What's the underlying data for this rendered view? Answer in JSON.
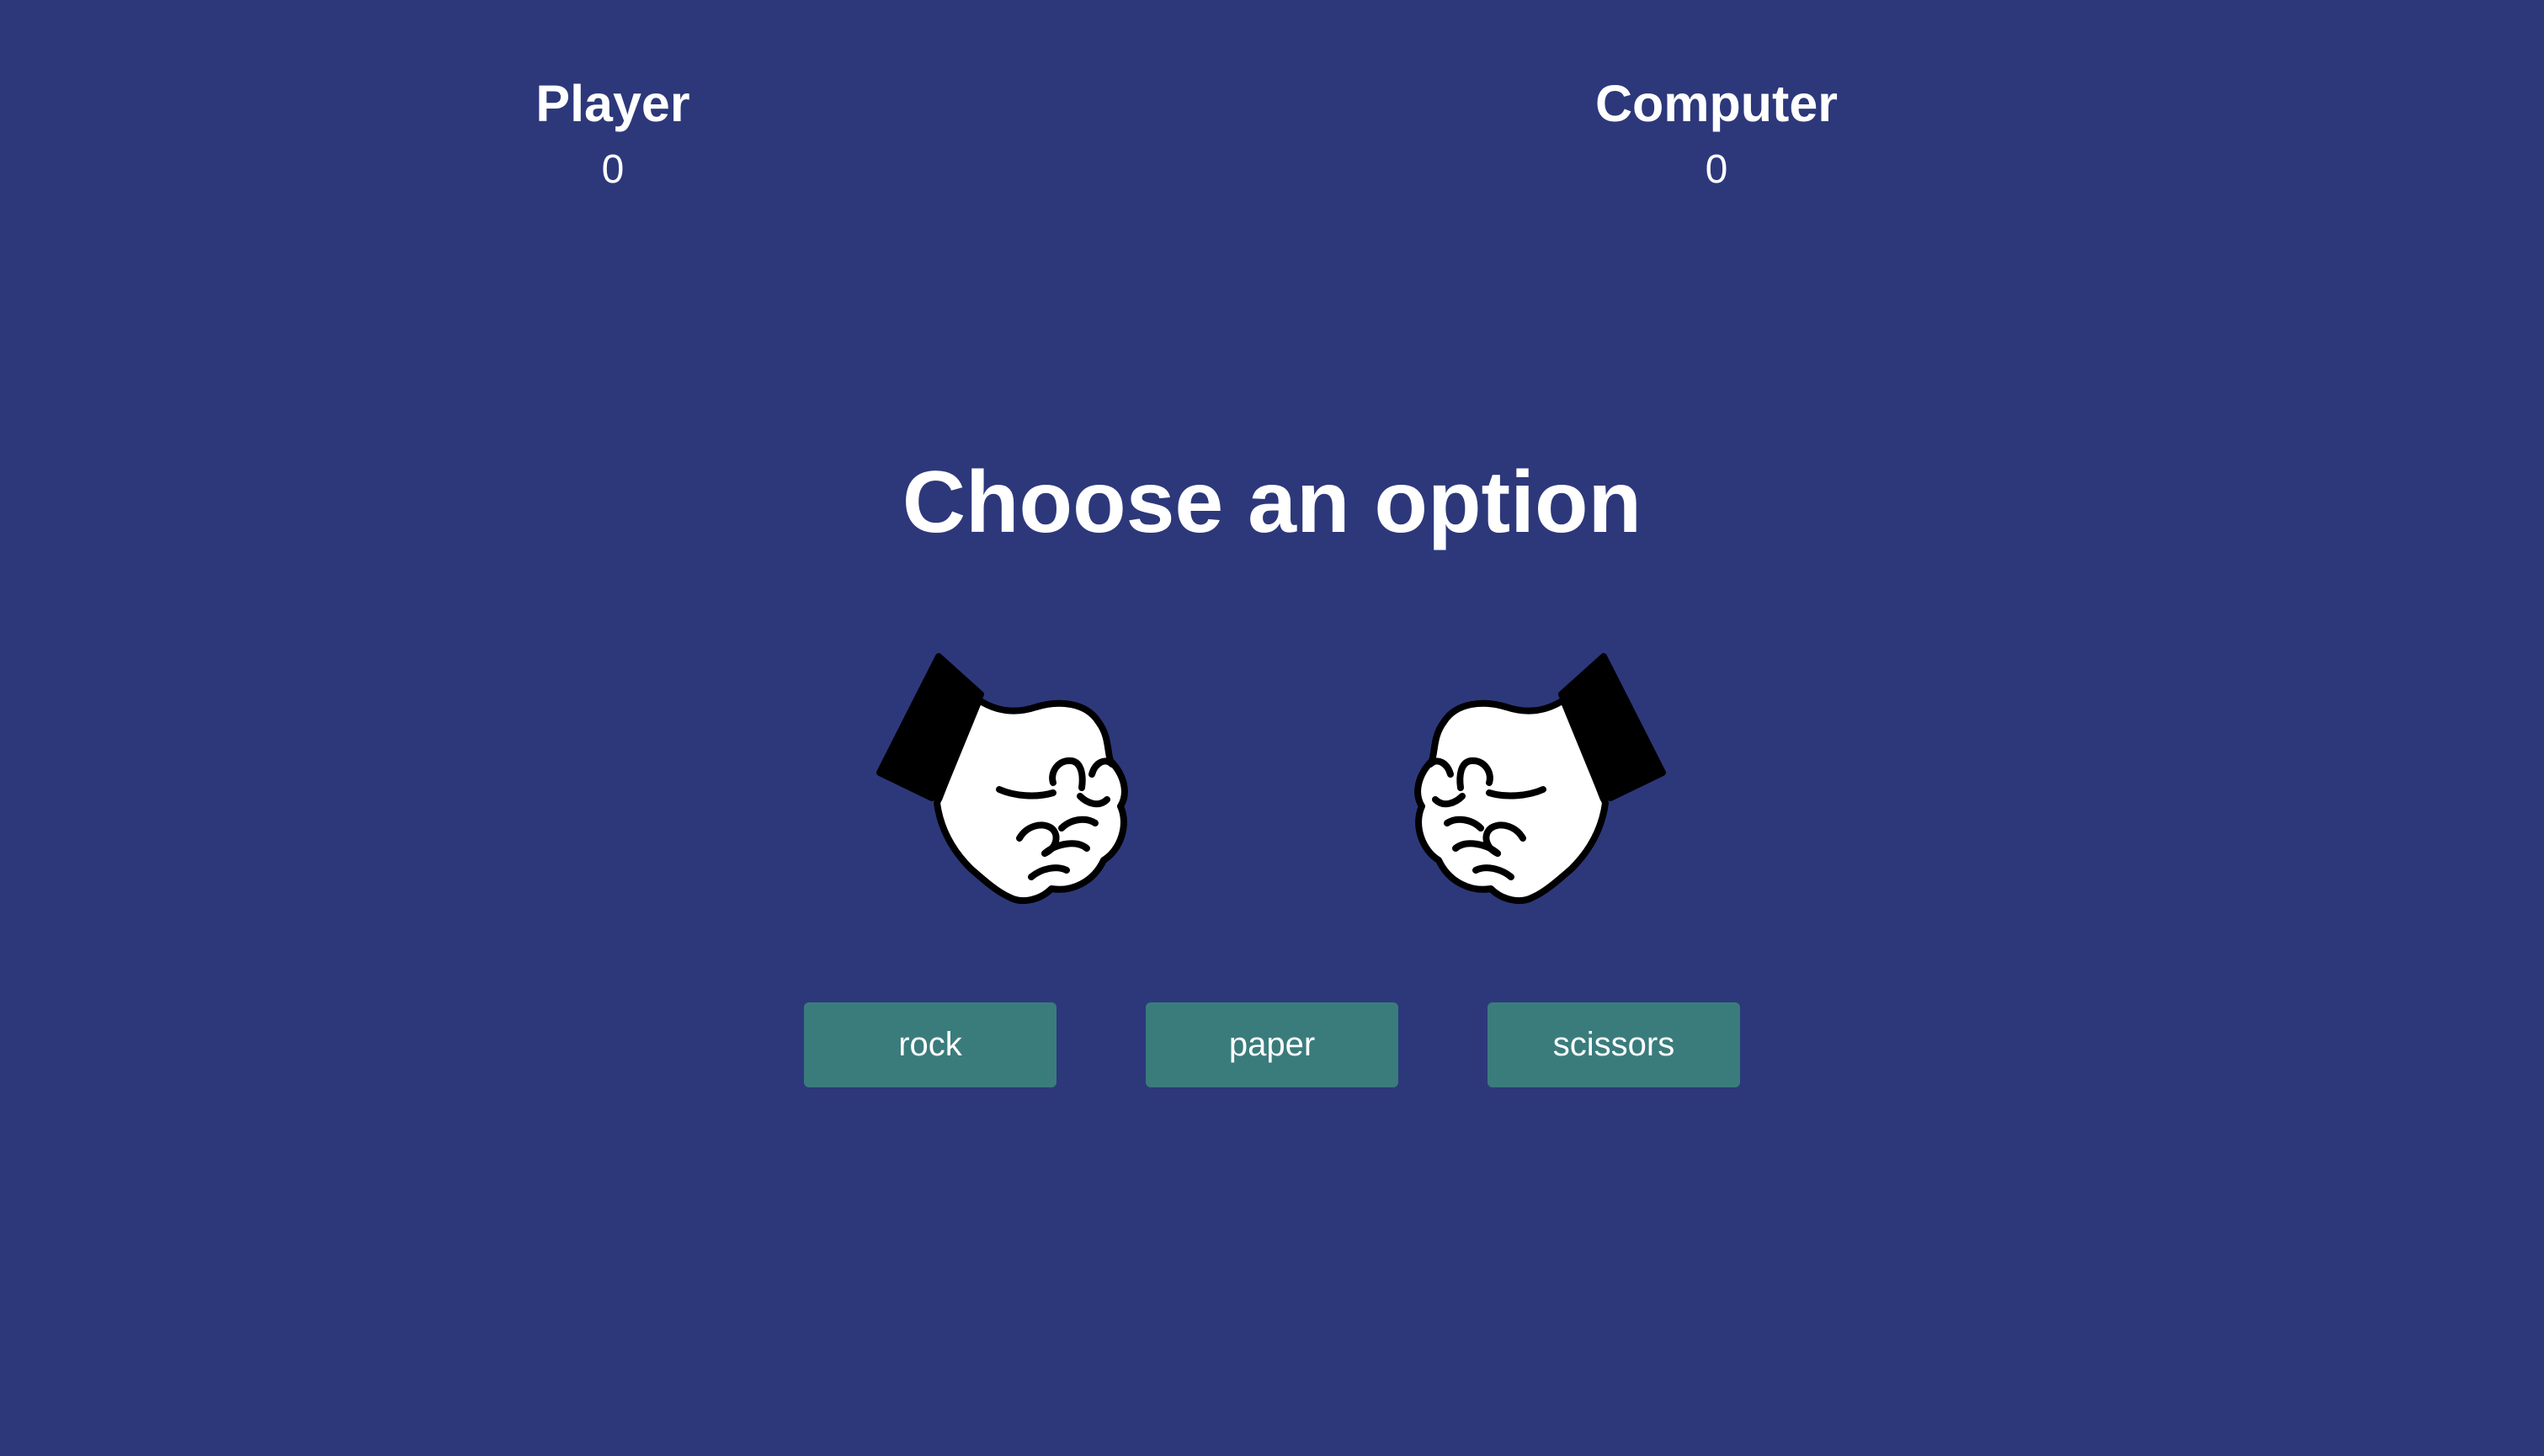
{
  "scoreboard": {
    "player": {
      "title": "Player",
      "score": "0"
    },
    "computer": {
      "title": "Computer",
      "score": "0"
    }
  },
  "heading": "Choose an option",
  "hands": {
    "player_icon": "fist-icon",
    "computer_icon": "fist-icon"
  },
  "choices": [
    {
      "label": "rock"
    },
    {
      "label": "paper"
    },
    {
      "label": "scissors"
    }
  ],
  "colors": {
    "background": "#2d387b",
    "button": "#3a7c7c",
    "text": "#ffffff"
  }
}
